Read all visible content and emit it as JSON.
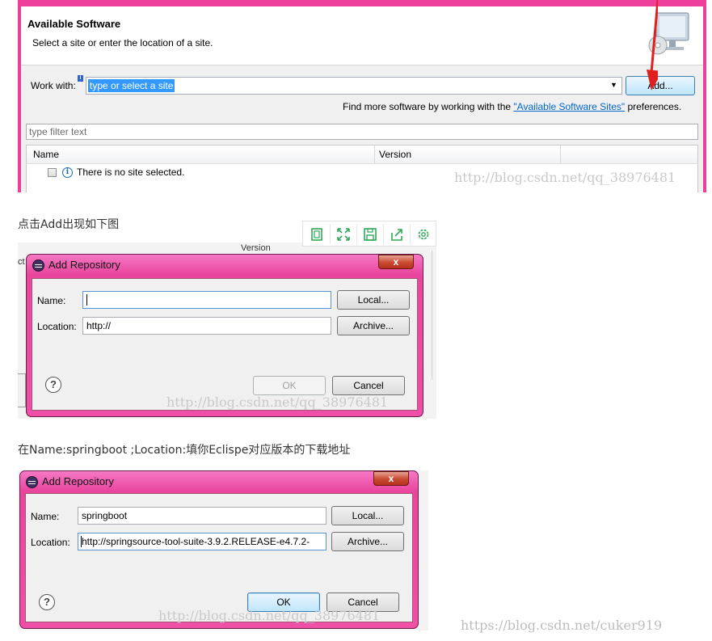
{
  "panel1": {
    "title": "Available Software",
    "subtitle": "Select a site or enter the location of a site.",
    "work_with_label": "Work with:",
    "info_badge": "i",
    "site_value": "type or select a site",
    "add_button": "Add...",
    "find_more_prefix": "Find more software by working with the ",
    "find_more_link": "\"Available Software Sites\"",
    "find_more_suffix": " preferences.",
    "filter_placeholder": "type filter text",
    "columns": [
      "Name",
      "Version"
    ],
    "row_text": "There is no site selected.",
    "watermark": "http://blog.csdn.net/qq_38976481"
  },
  "caption1": "点击Add出现如下图",
  "caption2": "在Name:springboot ;Location:填你Eclispe对应版本的下载地址",
  "toolbar": {
    "icons": [
      "fit-page-icon",
      "fullscreen-icon",
      "save-icon",
      "share-icon",
      "settings-icon"
    ]
  },
  "dialog1": {
    "title": "Add Repository",
    "close_label": "x",
    "name_label": "Name:",
    "name_value": "",
    "location_label": "Location:",
    "location_value": "http://",
    "local_button": "Local...",
    "archive_button": "Archive...",
    "ok_button": "OK",
    "cancel_button": "Cancel",
    "help": "?",
    "bg_version": "Version",
    "bg_ct": "ct",
    "watermark": "http://blog.csdn.net/qq_38976481"
  },
  "dialog2": {
    "title": "Add Repository",
    "close_label": "x",
    "name_label": "Name:",
    "name_value": "springboot",
    "location_label": "Location:",
    "location_value": "http://springsource-tool-suite-3.9.2.RELEASE-e4.7.2-",
    "local_button": "Local...",
    "archive_button": "Archive...",
    "ok_button": "OK",
    "cancel_button": "Cancel",
    "help": "?",
    "watermark": "http://blog.csdn.net/qq_38976481"
  },
  "page_watermark": "https://blog.csdn.net/cuker919",
  "colors": {
    "window_frame": "#ee3f9a",
    "selection": "#3399ff",
    "link": "#0066cc",
    "toolbar_icon": "#2eaa57",
    "arrow": "#e02020"
  }
}
